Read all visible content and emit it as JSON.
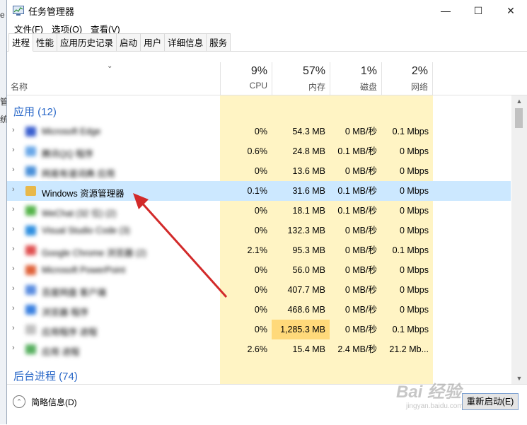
{
  "window": {
    "title": "任务管理器",
    "minimize": "—",
    "maximize": "☐",
    "close": "✕"
  },
  "menu": [
    "文件(F)",
    "选项(O)",
    "查看(V)"
  ],
  "tabs": [
    "进程",
    "性能",
    "应用历史记录",
    "启动",
    "用户",
    "详细信息",
    "服务"
  ],
  "active_tab": 0,
  "header": {
    "name_label": "名称",
    "cols": [
      {
        "pct": "9%",
        "label": "CPU"
      },
      {
        "pct": "57%",
        "label": "内存"
      },
      {
        "pct": "1%",
        "label": "磁盘"
      },
      {
        "pct": "2%",
        "label": "网络"
      }
    ]
  },
  "groups": {
    "apps": "应用 (12)",
    "background": "后台进程 (74)"
  },
  "rows": [
    {
      "name": "Microsoft Edge",
      "blurred": true,
      "icon_color": "#3a5fcf",
      "cpu": "0%",
      "mem": "54.3 MB",
      "disk": "0 MB/秒",
      "net": "0.1 Mbps"
    },
    {
      "name": "腾讯QQ 程序",
      "blurred": true,
      "icon_color": "#6aa8e8",
      "cpu": "0.6%",
      "mem": "24.8 MB",
      "disk": "0.1 MB/秒",
      "net": "0 Mbps"
    },
    {
      "name": "网易有道词典 应用",
      "blurred": true,
      "icon_color": "#4a90d9",
      "cpu": "0%",
      "mem": "13.6 MB",
      "disk": "0 MB/秒",
      "net": "0 Mbps"
    },
    {
      "name": "Windows 资源管理器",
      "blurred": false,
      "selected": true,
      "icon_color": "#e8b84a",
      "cpu": "0.1%",
      "mem": "31.6 MB",
      "disk": "0.1 MB/秒",
      "net": "0 Mbps"
    },
    {
      "name": "WeChat (32 位) (2)",
      "blurred": true,
      "icon_color": "#55b44a",
      "cpu": "0%",
      "mem": "18.1 MB",
      "disk": "0.1 MB/秒",
      "net": "0 Mbps"
    },
    {
      "name": "Visual Studio Code (3)",
      "blurred": true,
      "icon_color": "#2f8fe0",
      "cpu": "0%",
      "mem": "132.3 MB",
      "disk": "0 MB/秒",
      "net": "0 Mbps"
    },
    {
      "name": "Google Chrome 浏览器 (2)",
      "blurred": true,
      "icon_color": "#e05050",
      "cpu": "2.1%",
      "mem": "95.3 MB",
      "disk": "0 MB/秒",
      "net": "0.1 Mbps"
    },
    {
      "name": "Microsoft PowerPoint",
      "blurred": true,
      "icon_color": "#e0623a",
      "cpu": "0%",
      "mem": "56.0 MB",
      "disk": "0 MB/秒",
      "net": "0 Mbps"
    },
    {
      "name": "百度网盘 客户端",
      "blurred": true,
      "icon_color": "#5a8de0",
      "cpu": "0%",
      "mem": "407.7 MB",
      "disk": "0 MB/秒",
      "net": "0 Mbps"
    },
    {
      "name": "浏览器 程序",
      "blurred": true,
      "icon_color": "#3a80e0",
      "cpu": "0%",
      "mem": "468.6 MB",
      "disk": "0 MB/秒",
      "net": "0 Mbps"
    },
    {
      "name": "应用程序 进程",
      "blurred": true,
      "icon_color": "#c0c0c0",
      "cpu": "0%",
      "mem": "1,285.3 MB",
      "mem_hot": true,
      "disk": "0 MB/秒",
      "net": "0.1 Mbps"
    },
    {
      "name": "应用 进程",
      "blurred": true,
      "icon_color": "#58b060",
      "cpu": "2.6%",
      "mem": "15.4 MB",
      "disk": "2.4 MB/秒",
      "net": "21.2 Mb..."
    }
  ],
  "footer": {
    "fewer_details": "简略信息(D)",
    "restart": "重新启动(E)"
  },
  "left_strip": [
    "e",
    "管",
    "统"
  ],
  "watermark": {
    "line1": "Bai 经验",
    "line2": "jingyan.baidu.com"
  },
  "colors": {
    "group_text": "#2a68c8",
    "selected_row": "#cce8ff",
    "heat_light": "#fff4c4",
    "heat_strong": "#ffd97a",
    "arrow": "#d22a2a"
  }
}
